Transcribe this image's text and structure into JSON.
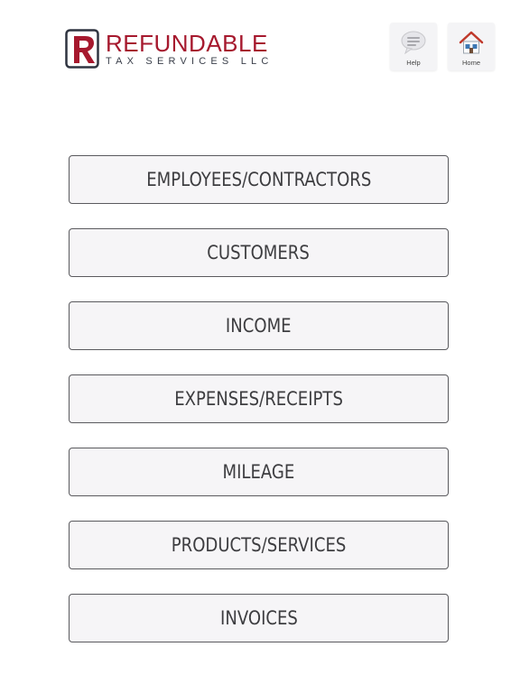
{
  "header": {
    "logo": {
      "name": "REFUNDABLE",
      "subtitle": "TAX SERVICES LLC"
    },
    "help_label": "Help",
    "home_label": "Home"
  },
  "menu": {
    "items": [
      {
        "label": "EMPLOYEES/CONTRACTORS"
      },
      {
        "label": "CUSTOMERS"
      },
      {
        "label": "INCOME"
      },
      {
        "label": "EXPENSES/RECEIPTS"
      },
      {
        "label": "MILEAGE"
      },
      {
        "label": "PRODUCTS/SERVICES"
      },
      {
        "label": "INVOICES"
      }
    ]
  },
  "colors": {
    "brand_red": "#a6192e",
    "brand_dark": "#2f3440",
    "button_border": "#5a5a5e",
    "button_fill": "#f6f5f7"
  }
}
